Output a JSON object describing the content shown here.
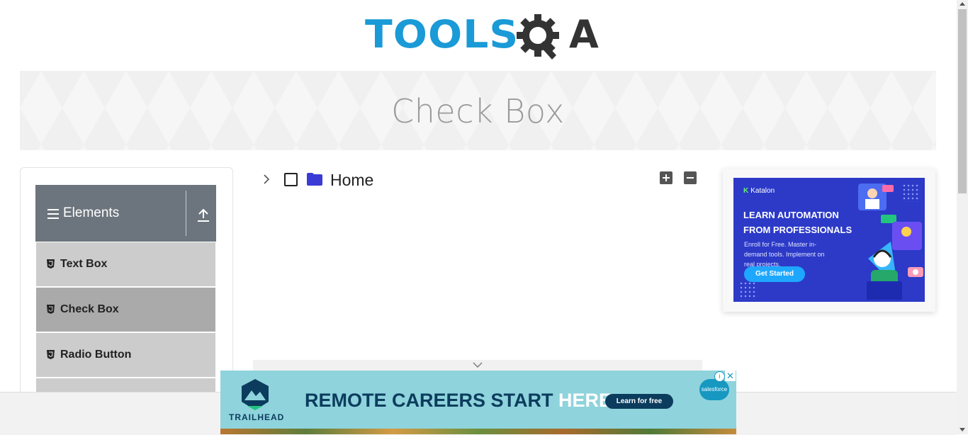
{
  "header": {
    "logo_text": "TOOLS",
    "logo_suffix": "A"
  },
  "banner": {
    "title": "Check Box"
  },
  "sidebar": {
    "group": {
      "title": "Elements",
      "icon": "hamburger-icon",
      "toggle_icon": "collapse-up-icon"
    },
    "items": [
      {
        "label": "Text Box",
        "icon": "html5-icon",
        "active": false
      },
      {
        "label": "Check Box",
        "icon": "html5-icon",
        "active": true
      },
      {
        "label": "Radio Button",
        "icon": "html5-icon",
        "active": false
      }
    ]
  },
  "tree": {
    "root": {
      "label": "Home",
      "checked": false,
      "expanded": false,
      "icons": [
        "chevron-right-icon",
        "checkbox-icon",
        "folder-icon"
      ]
    },
    "controls": {
      "expand_all": "plus-square-icon",
      "collapse_all": "minus-square-icon"
    }
  },
  "right_ad": {
    "brand": "Katalon",
    "headline_line1": "LEARN AUTOMATION",
    "headline_line2": "FROM PROFESSIONALS",
    "subtext": "Enroll for Free. Master in-demand tools. Implement on real projects.",
    "cta": "Get Started"
  },
  "bottom_ad": {
    "brand": "TRAILHEAD",
    "headline_main": "REMOTE CAREERS START ",
    "headline_highlight": "HERE.",
    "cta": "Learn for free",
    "sponsor": "salesforce",
    "info": "i",
    "close": "✕"
  },
  "colors": {
    "logo_blue": "#1a9ad6",
    "sidebar_header": "#6c757d",
    "menu_item": "#cccccc",
    "menu_item_active": "#aaaaaa",
    "folder": "#3b3bd6",
    "ad_bg": "#2c3ac7",
    "trailhead_bg": "#8fd3dc"
  }
}
